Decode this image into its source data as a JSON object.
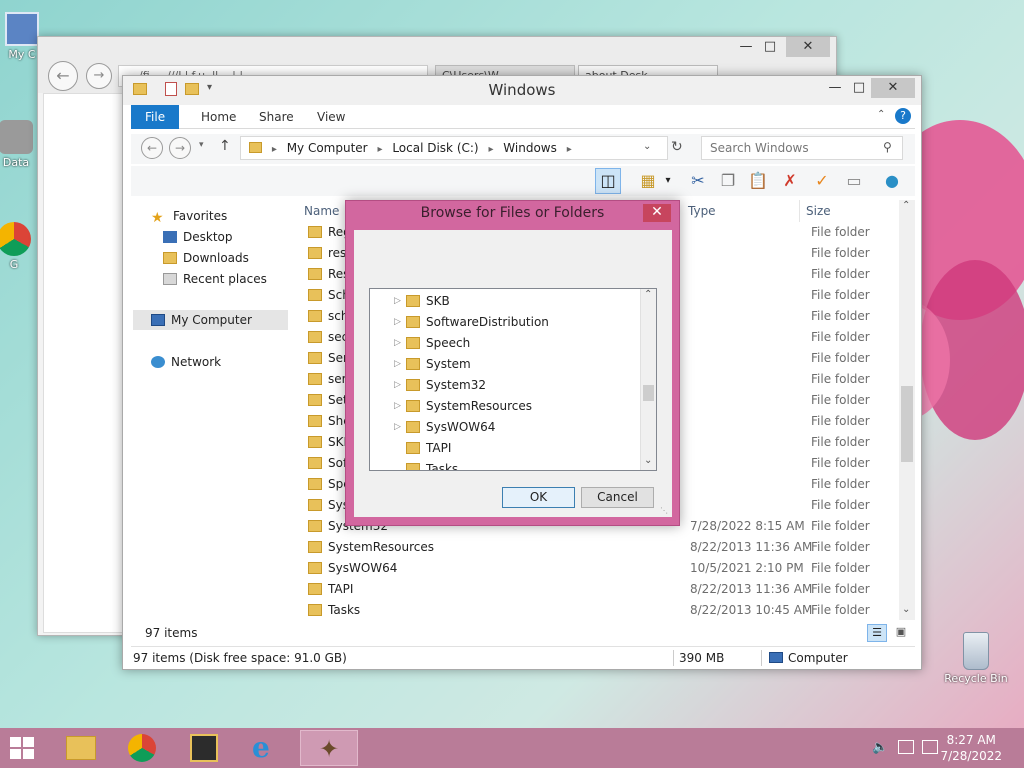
{
  "desktop": {
    "icons": [
      {
        "label": "My C",
        "icon": "computer-icon"
      },
      {
        "label": "Data",
        "icon": "database-icon"
      },
      {
        "label": "G",
        "icon": "chrome-icon"
      },
      {
        "label": "Recycle Bin",
        "icon": "recycle-bin-icon"
      }
    ]
  },
  "ie_window": {
    "address_text": "/fi.... ///I.l.f.u..ll....| |..",
    "tabs": [
      "C\\Users\\W...",
      "about Desk..."
    ]
  },
  "explorer": {
    "title": "Windows",
    "ribbon_tabs": [
      "File",
      "Home",
      "Share",
      "View"
    ],
    "address": {
      "segments": [
        "My Computer",
        "Local Disk (C:)",
        "Windows"
      ]
    },
    "search_placeholder": "Search Windows",
    "nav": {
      "favorites_label": "Favorites",
      "favorites": [
        "Desktop",
        "Downloads",
        "Recent places"
      ],
      "my_computer": "My Computer",
      "network": "Network"
    },
    "columns": {
      "name": "Name",
      "type": "Type",
      "size": "Size"
    },
    "files": [
      {
        "name": "Reg",
        "date": "",
        "type": "File folder"
      },
      {
        "name": "reso",
        "date": "",
        "type": "File folder"
      },
      {
        "name": "Res",
        "date": "",
        "type": "File folder"
      },
      {
        "name": "Sch",
        "date": "",
        "type": "File folder"
      },
      {
        "name": "sch",
        "date": "",
        "type": "File folder"
      },
      {
        "name": "sec",
        "date": "",
        "type": "File folder"
      },
      {
        "name": "Ser",
        "date": "",
        "type": "File folder"
      },
      {
        "name": "serv",
        "date": "",
        "type": "File folder"
      },
      {
        "name": "Set",
        "date": "",
        "type": "File folder"
      },
      {
        "name": "She",
        "date": "",
        "type": "File folder"
      },
      {
        "name": "SKB",
        "date": "",
        "type": "File folder"
      },
      {
        "name": "Sof",
        "date": "",
        "type": "File folder"
      },
      {
        "name": "Spe",
        "date": "",
        "type": "File folder"
      },
      {
        "name": "Sys",
        "date": "",
        "type": "File folder"
      },
      {
        "name": "System32",
        "date": "7/28/2022 8:15 AM",
        "type": "File folder"
      },
      {
        "name": "SystemResources",
        "date": "8/22/2013 11:36 AM",
        "type": "File folder"
      },
      {
        "name": "SysWOW64",
        "date": "10/5/2021 2:10 PM",
        "type": "File folder"
      },
      {
        "name": "TAPI",
        "date": "8/22/2013 11:36 AM",
        "type": "File folder"
      },
      {
        "name": "Tasks",
        "date": "8/22/2013 10:45 AM",
        "type": "File folder"
      }
    ],
    "item_count": "97 items",
    "status": {
      "left": "97 items (Disk free space: 91.0 GB)",
      "size": "390 MB",
      "location": "Computer"
    }
  },
  "dialog": {
    "title": "Browse for Files or Folders",
    "tree": [
      {
        "name": "SKB",
        "expandable": true
      },
      {
        "name": "SoftwareDistribution",
        "expandable": true
      },
      {
        "name": "Speech",
        "expandable": true
      },
      {
        "name": "System",
        "expandable": true
      },
      {
        "name": "System32",
        "expandable": true
      },
      {
        "name": "SystemResources",
        "expandable": true
      },
      {
        "name": "SysWOW64",
        "expandable": true
      },
      {
        "name": "TAPI",
        "expandable": false
      },
      {
        "name": "Tasks",
        "expandable": false
      }
    ],
    "ok_label": "OK",
    "cancel_label": "Cancel"
  },
  "taskbar": {
    "time": "8:27 AM",
    "date": "7/28/2022",
    "apps": [
      "file-explorer-icon",
      "chrome-icon",
      "app-icon",
      "internet-explorer-icon",
      "wand-icon"
    ]
  },
  "colors": {
    "ribbon_accent": "#1979ca",
    "dialog_frame": "#d2679f",
    "taskbar": "#b97c98"
  }
}
